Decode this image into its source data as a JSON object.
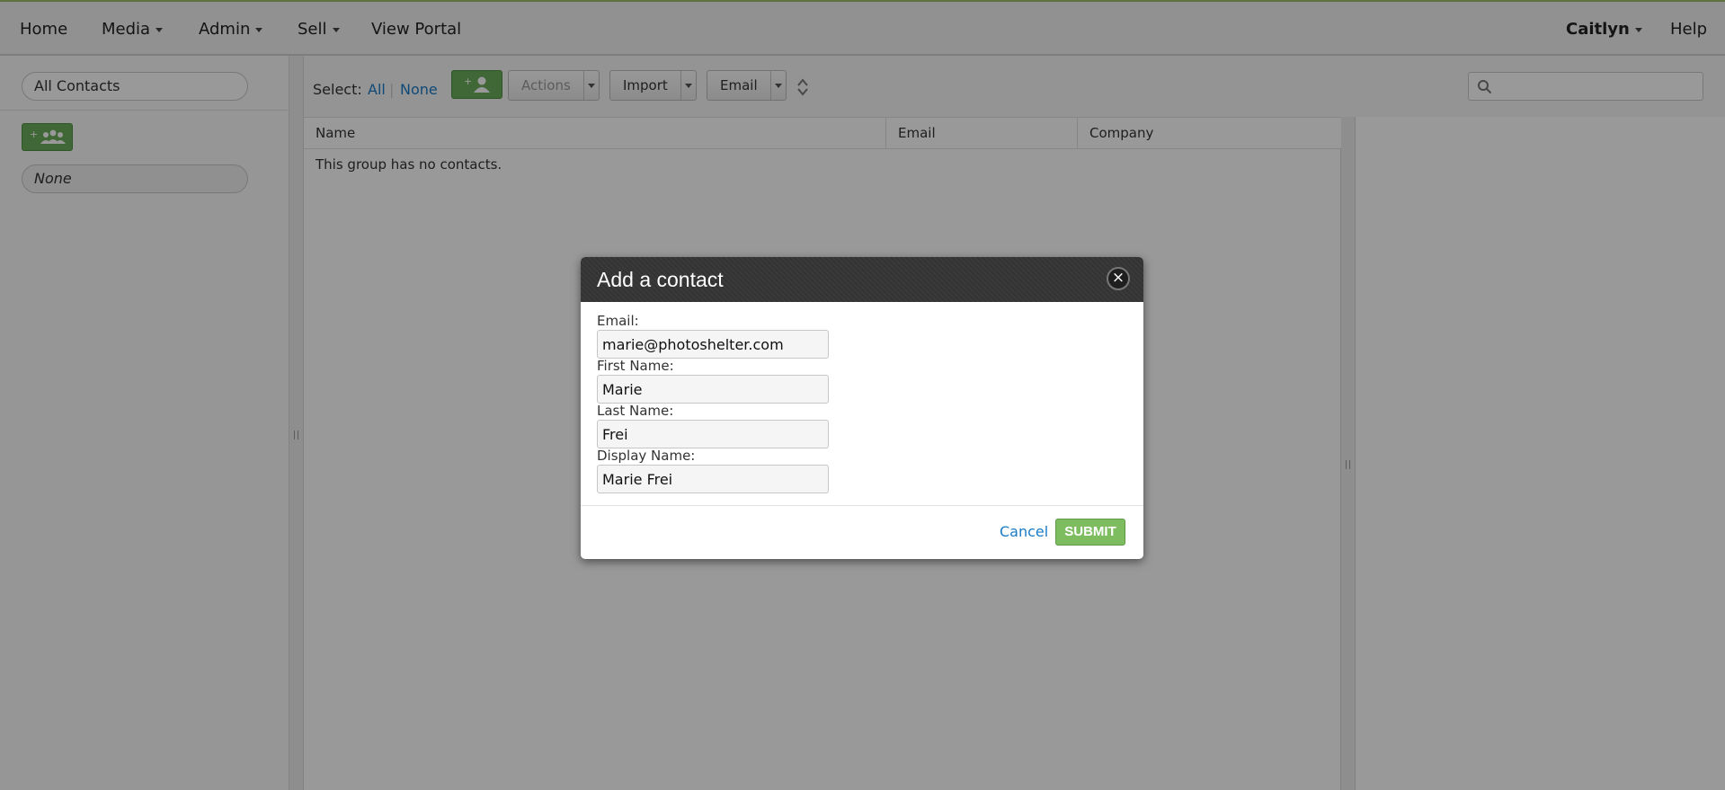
{
  "nav": {
    "home": "Home",
    "media": "Media",
    "admin": "Admin",
    "sell": "Sell",
    "view_portal": "View Portal",
    "user": "Caitlyn",
    "help": "Help"
  },
  "sidebar": {
    "all_contacts": "All Contacts",
    "group_none": "None",
    "add_group_icon": "add-group-icon"
  },
  "toolbar": {
    "select_label": "Select:",
    "select_all": "All",
    "select_none": "None",
    "add_contact_icon": "add-contact-icon",
    "actions": "Actions",
    "import": "Import",
    "email": "Email",
    "search_icon": "search-icon"
  },
  "table": {
    "columns": [
      "Name",
      "Email",
      "Company"
    ],
    "empty_message": "This group has no contacts."
  },
  "modal": {
    "title": "Add a contact",
    "close_glyph": "×",
    "fields": [
      {
        "label": "Email:",
        "value": "marie@photoshelter.com"
      },
      {
        "label": "First Name:",
        "value": "Marie"
      },
      {
        "label": "Last Name:",
        "value": "Frei"
      },
      {
        "label": "Display Name:",
        "value": "Marie Frei"
      }
    ],
    "cancel": "Cancel",
    "submit": "SUBMIT"
  },
  "colors": {
    "accent_green": "#6cae5a",
    "link_blue": "#1a7bc6"
  }
}
